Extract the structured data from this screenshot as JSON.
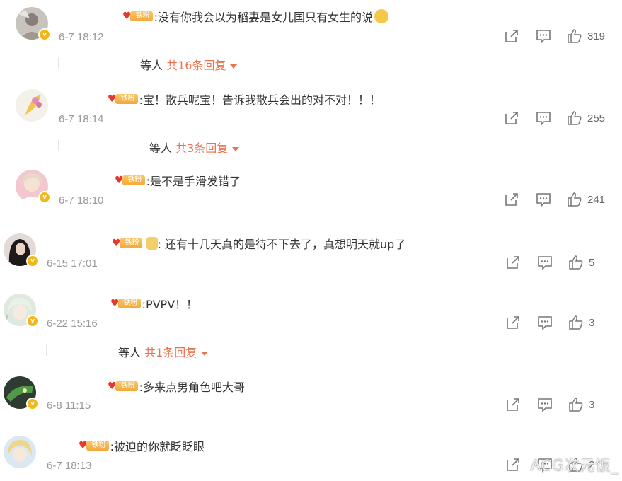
{
  "badge_label": "铁粉",
  "comments": [
    {
      "text": ":没有你我会以为稻妻是女儿国只有女生的说",
      "time": "6-7 18:12",
      "likes": "319",
      "has_emoji": true,
      "reply": {
        "lead": "等人",
        "count": "共16条回复"
      }
    },
    {
      "text": ":宝！散兵呢宝！告诉我散兵会出的对不对！！！",
      "time": "6-7 18:14",
      "likes": "255",
      "reply": {
        "lead": "等人",
        "count": "共3条回复"
      }
    },
    {
      "text": ":是不是手滑发错了",
      "time": "6-7 18:10",
      "likes": "241"
    },
    {
      "text": ": 还有十几天真的是待不下去了，真想明天就up了",
      "time": "6-15 17:01",
      "likes": "5"
    },
    {
      "text": ":PVPV！！",
      "time": "6-22 15:16",
      "likes": "3",
      "reply": {
        "lead": "等人",
        "count": "共1条回复"
      }
    },
    {
      "text": ":多来点男角色吧大哥",
      "time": "6-8 11:15",
      "likes": "3"
    },
    {
      "text": ":被迫的你就眨眨眼",
      "time": "6-7 18:13",
      "likes": "2"
    }
  ],
  "watermark": "ACG次元饭_",
  "colors": {
    "reply_accent": "#eb7350",
    "badge": "#f2a93b",
    "timestamp": "#999999"
  }
}
